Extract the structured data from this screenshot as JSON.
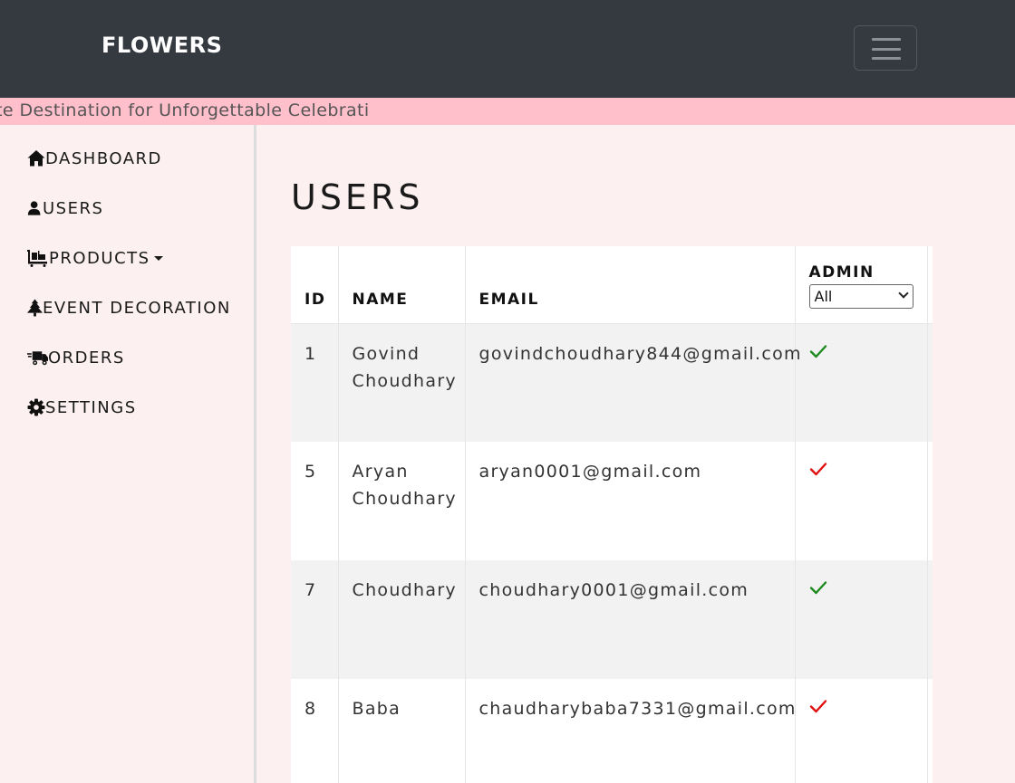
{
  "navbar": {
    "brand": "FLOWERS",
    "menu_icon": "hamburger-menu-icon"
  },
  "marquee": {
    "text": "gance - Your Ultimate Destination for Unforgettable Celebrati"
  },
  "sidebar": {
    "items": [
      {
        "label": "DASHBOARD",
        "icon": "home-icon"
      },
      {
        "label": "USERS",
        "icon": "user-icon"
      },
      {
        "label": " PRODUCTS",
        "icon": "cart-icon"
      },
      {
        "label": "EVENT DECORATION",
        "icon": "tree-icon"
      },
      {
        "label": "ORDERS",
        "icon": "truck-icon"
      },
      {
        "label": "SETTINGS",
        "icon": "gear-icon"
      }
    ]
  },
  "page": {
    "title": "USERS"
  },
  "table": {
    "headers": {
      "id": "ID",
      "name": "NAME",
      "email": "EMAIL",
      "admin": "ADMIN"
    },
    "admin_filter": {
      "selected": "All"
    },
    "rows": [
      {
        "id": "1",
        "name_line1": "Govind",
        "name_line2": "Choudhary",
        "email": "govindchoudhary844@gmail.com",
        "admin": true
      },
      {
        "id": "5",
        "name_line1": "Aryan",
        "name_line2": "Choudhary",
        "email": "aryan0001@gmail.com",
        "admin": false
      },
      {
        "id": "7",
        "name_line1": "Choudhary",
        "name_line2": "",
        "email": "choudhary0001@gmail.com",
        "admin": true
      },
      {
        "id": "8",
        "name_line1": "Baba",
        "name_line2": "",
        "email": "chaudharybaba7331@gmail.com",
        "admin": false
      }
    ]
  },
  "colors": {
    "navbar": "#343a40",
    "marquee": "#ffc0cb",
    "page_bg": "#fcf0f0",
    "admin_yes": "#1e8a1e",
    "admin_no": "#e01010"
  }
}
